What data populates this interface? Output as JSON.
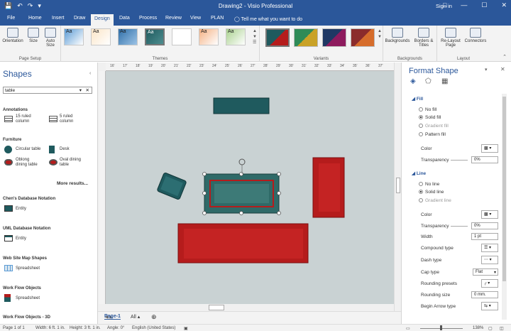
{
  "window": {
    "title": "Drawing2 - Visio Professional",
    "signin": "Sign in"
  },
  "tabs": [
    "File",
    "Home",
    "Insert",
    "Draw",
    "Design",
    "Data",
    "Process",
    "Review",
    "View",
    "PLAN"
  ],
  "active_tab": "Design",
  "tellme": "Tell me what you want to do",
  "ribbon": {
    "page_setup": {
      "label": "Page Setup",
      "orientation": "Orientation",
      "size": "Size",
      "auto_size": "Auto\nSize"
    },
    "themes": {
      "label": "Themes",
      "items": [
        "Aa",
        "Aa",
        "Aa",
        "Aa",
        "",
        "Aa",
        "Aa"
      ]
    },
    "variants": {
      "label": "Variants"
    },
    "backgrounds": {
      "label": "Backgrounds",
      "backgrounds": "Backgrounds",
      "borders": "Borders &\nTitles"
    },
    "layout": {
      "label": "Layout",
      "relayout": "Re-Layout\nPage",
      "connectors": "Connectors"
    }
  },
  "shapes": {
    "title": "Shapes",
    "search_value": "table",
    "groups": [
      {
        "name": "Annotations",
        "items": [
          "15 ruled\ncolumn",
          "5 ruled\ncolumn"
        ]
      },
      {
        "name": "Furniture",
        "items": [
          "Circular table",
          "Desk",
          "Oblong\ndining table",
          "Oval dining\ntable"
        ]
      },
      {
        "more": "More results..."
      },
      {
        "name": "Chen's Database Notation",
        "items": [
          "Entity"
        ]
      },
      {
        "name": "UML Database Notation",
        "items": [
          "Entity"
        ]
      },
      {
        "name": "Web Site Map Shapes",
        "items": [
          "Spreadsheet"
        ]
      },
      {
        "name": "Work Flow Objects",
        "items": [
          "Spreadsheet"
        ]
      },
      {
        "name": "Work Flow Objects - 3D",
        "items": []
      }
    ]
  },
  "ruler_ticks": [
    "16'",
    "17'",
    "18'",
    "19'",
    "20'",
    "21'",
    "22'",
    "23'",
    "24'",
    "25'",
    "26'",
    "27'",
    "28'",
    "29'",
    "30'",
    "31'",
    "32'",
    "33'",
    "34'",
    "35'",
    "36'",
    "37'"
  ],
  "pages": {
    "current": "Page-1",
    "all": "All"
  },
  "format": {
    "title": "Format Shape",
    "fill": {
      "label": "Fill",
      "options": [
        "No fill",
        "Solid fill",
        "Gradient fill",
        "Pattern fill"
      ],
      "selected": "Solid fill",
      "color_label": "Color",
      "transparency_label": "Transparency",
      "transparency": "0%"
    },
    "line": {
      "label": "Line",
      "options": [
        "No line",
        "Solid line",
        "Gradient line"
      ],
      "selected": "Solid line",
      "color_label": "Color",
      "transparency_label": "Transparency",
      "transparency": "0%",
      "width_label": "Width",
      "width": "1 pt",
      "compound_label": "Compound type",
      "dash_label": "Dash type",
      "cap_label": "Cap type",
      "cap": "Flat",
      "rounding_presets_label": "Rounding presets",
      "rounding_size_label": "Rounding size",
      "rounding_size": "0 mm.",
      "begin_arrow_label": "Begin Arrow type"
    }
  },
  "status": {
    "page": "Page 1 of 1",
    "width": "Width: 6 ft. 1 in.",
    "height": "Height: 3 ft. 1 in.",
    "angle": "Angle: 0°",
    "language": "English (United States)",
    "zoom": "138%"
  },
  "colors": {
    "accent": "#2b579a",
    "teal": "#1f5a5e",
    "red": "#b51c1c"
  }
}
